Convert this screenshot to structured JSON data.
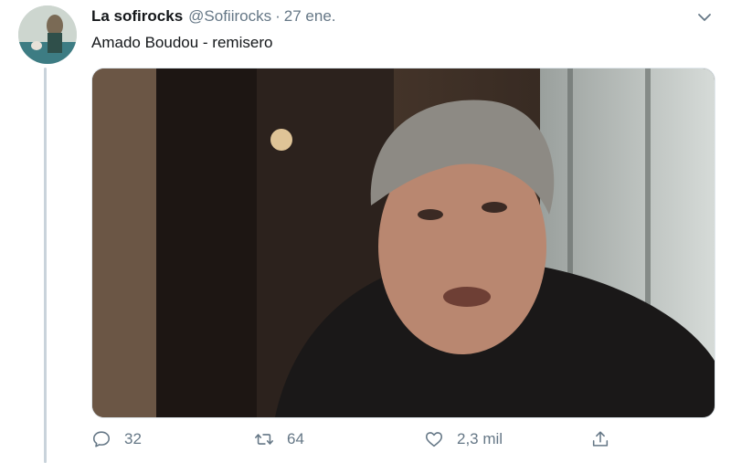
{
  "tweet": {
    "author_name": "La sofirocks",
    "author_handle": "@Sofiirocks",
    "separator": "·",
    "date": "27 ene.",
    "text": "Amado Boudou - remisero"
  },
  "icons": {
    "menu": "chevron-down-icon",
    "reply": "reply-icon",
    "retweet": "retweet-icon",
    "like": "heart-icon",
    "share": "share-icon"
  },
  "actions": {
    "replies": "32",
    "retweets": "64",
    "likes": "2,3 mil"
  },
  "colors": {
    "muted": "#657786",
    "thread_line": "#c9d3db"
  }
}
